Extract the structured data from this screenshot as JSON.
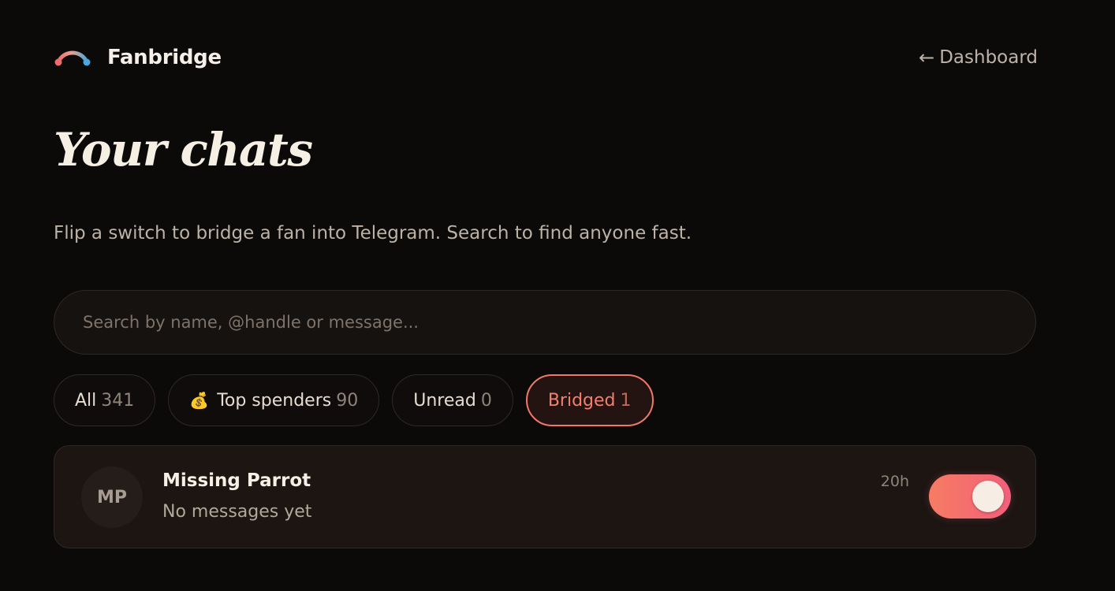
{
  "brand": {
    "name": "Fanbridge",
    "logo_icon": "bridge-arc-icon"
  },
  "nav": {
    "back_arrow": "←",
    "back_label": "Dashboard"
  },
  "header": {
    "title": "Your chats",
    "subtitle": "Flip a switch to bridge a fan into Telegram. Search to find anyone fast."
  },
  "search": {
    "placeholder": "Search by name, @handle or message...",
    "value": ""
  },
  "filters": [
    {
      "label": "All",
      "count": "341",
      "emoji": "",
      "active": false
    },
    {
      "label": "Top spenders",
      "count": "90",
      "emoji": "💰",
      "active": false
    },
    {
      "label": "Unread",
      "count": "0",
      "emoji": "",
      "active": false
    },
    {
      "label": "Bridged",
      "count": "1",
      "emoji": "",
      "active": true
    }
  ],
  "chats": [
    {
      "initials": "MP",
      "name": "Missing Parrot",
      "preview": "No messages yet",
      "time": "20h",
      "bridged": true
    }
  ],
  "colors": {
    "background": "#0c0a09",
    "accent": "#f0786a",
    "toggle_start": "#f67c63",
    "toggle_end": "#f2607a",
    "logo_left": "#f06b6b",
    "logo_right": "#4aa8dc"
  }
}
